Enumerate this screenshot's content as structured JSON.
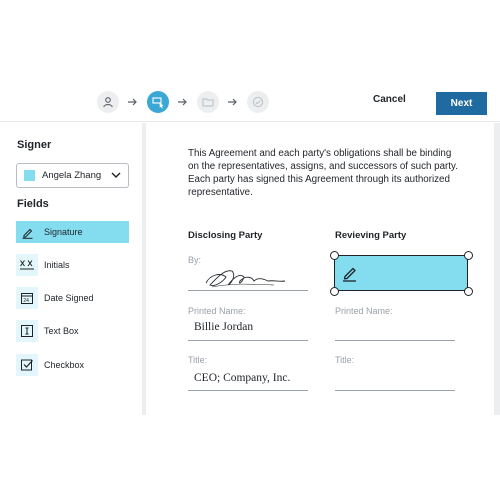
{
  "header": {
    "steps": [
      {
        "icon": "person-icon",
        "active": false
      },
      {
        "icon": "place-field-icon",
        "active": true
      },
      {
        "icon": "folder-icon",
        "active": false
      },
      {
        "icon": "check-circle-icon",
        "active": false
      }
    ],
    "cancel_label": "Cancel",
    "next_label": "Next"
  },
  "sidebar": {
    "signer_title": "Signer",
    "signer": {
      "name": "Angela Zhang",
      "color": "#84dcef"
    },
    "fields_title": "Fields",
    "fields": [
      {
        "label": "Signature",
        "icon": "pen-icon",
        "selected": true
      },
      {
        "label": "Initials",
        "icon": "initials-icon",
        "selected": false
      },
      {
        "label": "Date Signed",
        "icon": "calendar-icon",
        "selected": false
      },
      {
        "label": "Text Box",
        "icon": "text-cursor-icon",
        "selected": false
      },
      {
        "label": "Checkbox",
        "icon": "checkbox-icon",
        "selected": false
      }
    ]
  },
  "document": {
    "paragraph": "This Agreement and each party's obligations shall be binding on the representatives, assigns, and successors of such party. Each party has signed this Agreement through its authorized representative.",
    "disclosing": {
      "heading": "Disclosing Party",
      "by_label": "By:",
      "printed_name_label": "Printed Name:",
      "printed_name": "Billie Jordan",
      "title_label": "Title:",
      "title": "CEO; Company, Inc."
    },
    "receiving": {
      "heading": "Revieving Party",
      "printed_name_label": "Printed Name:",
      "title_label": "Title:"
    }
  },
  "colors": {
    "accent": "#1f6aa0",
    "active_step": "#3aa7d4",
    "field_fill": "#84dcef"
  }
}
